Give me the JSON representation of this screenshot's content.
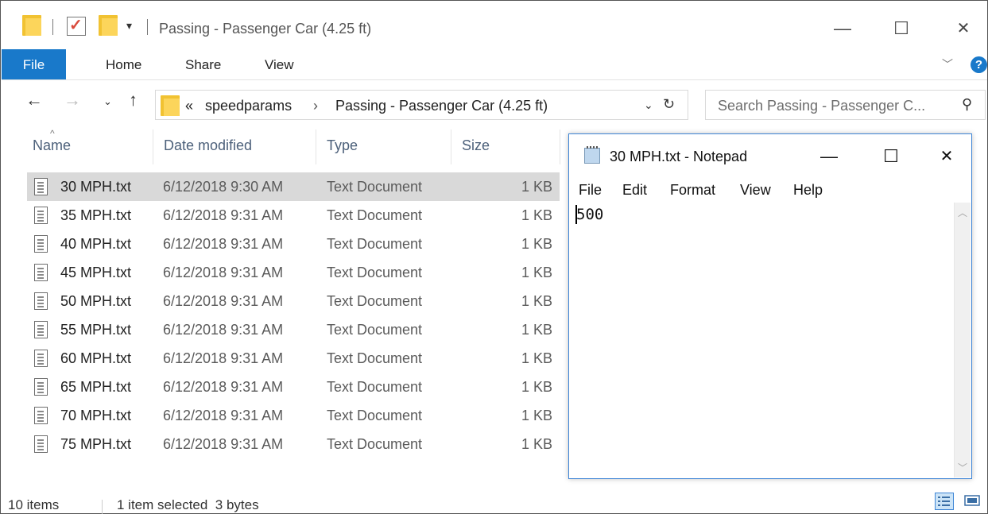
{
  "explorer": {
    "window_title": "Passing - Passenger Car (4.25 ft)",
    "title_buttons": {
      "minimize": "—",
      "maximize": "☐",
      "close": "✕"
    },
    "ribbon_tabs": [
      "File",
      "Home",
      "Share",
      "View"
    ],
    "breadcrumb": {
      "overflow": "«",
      "segments": [
        "speedparams",
        "Passing - Passenger Car (4.25 ft)"
      ],
      "separator": "›"
    },
    "search_placeholder": "Search Passing - Passenger C...",
    "columns": [
      "Name",
      "Date modified",
      "Type",
      "Size"
    ],
    "files": [
      {
        "name": "30 MPH.txt",
        "date": "6/12/2018 9:30 AM",
        "type": "Text Document",
        "size": "1 KB",
        "selected": true
      },
      {
        "name": "35 MPH.txt",
        "date": "6/12/2018 9:31 AM",
        "type": "Text Document",
        "size": "1 KB",
        "selected": false
      },
      {
        "name": "40 MPH.txt",
        "date": "6/12/2018 9:31 AM",
        "type": "Text Document",
        "size": "1 KB",
        "selected": false
      },
      {
        "name": "45 MPH.txt",
        "date": "6/12/2018 9:31 AM",
        "type": "Text Document",
        "size": "1 KB",
        "selected": false
      },
      {
        "name": "50 MPH.txt",
        "date": "6/12/2018 9:31 AM",
        "type": "Text Document",
        "size": "1 KB",
        "selected": false
      },
      {
        "name": "55 MPH.txt",
        "date": "6/12/2018 9:31 AM",
        "type": "Text Document",
        "size": "1 KB",
        "selected": false
      },
      {
        "name": "60 MPH.txt",
        "date": "6/12/2018 9:31 AM",
        "type": "Text Document",
        "size": "1 KB",
        "selected": false
      },
      {
        "name": "65 MPH.txt",
        "date": "6/12/2018 9:31 AM",
        "type": "Text Document",
        "size": "1 KB",
        "selected": false
      },
      {
        "name": "70 MPH.txt",
        "date": "6/12/2018 9:31 AM",
        "type": "Text Document",
        "size": "1 KB",
        "selected": false
      },
      {
        "name": "75 MPH.txt",
        "date": "6/12/2018 9:31 AM",
        "type": "Text Document",
        "size": "1 KB",
        "selected": false
      }
    ],
    "status": {
      "items": "10 items",
      "selection": "1 item selected  3 bytes"
    },
    "colors": {
      "accent": "#1979ca",
      "selected_row": "#d9d9d9",
      "header_text": "#4c607a"
    }
  },
  "notepad": {
    "title": "30 MPH.txt - Notepad",
    "title_buttons": {
      "minimize": "—",
      "maximize": "☐",
      "close": "✕"
    },
    "menu": [
      "File",
      "Edit",
      "Format",
      "View",
      "Help"
    ],
    "content": "500",
    "colors": {
      "border": "#3f86d6"
    }
  }
}
